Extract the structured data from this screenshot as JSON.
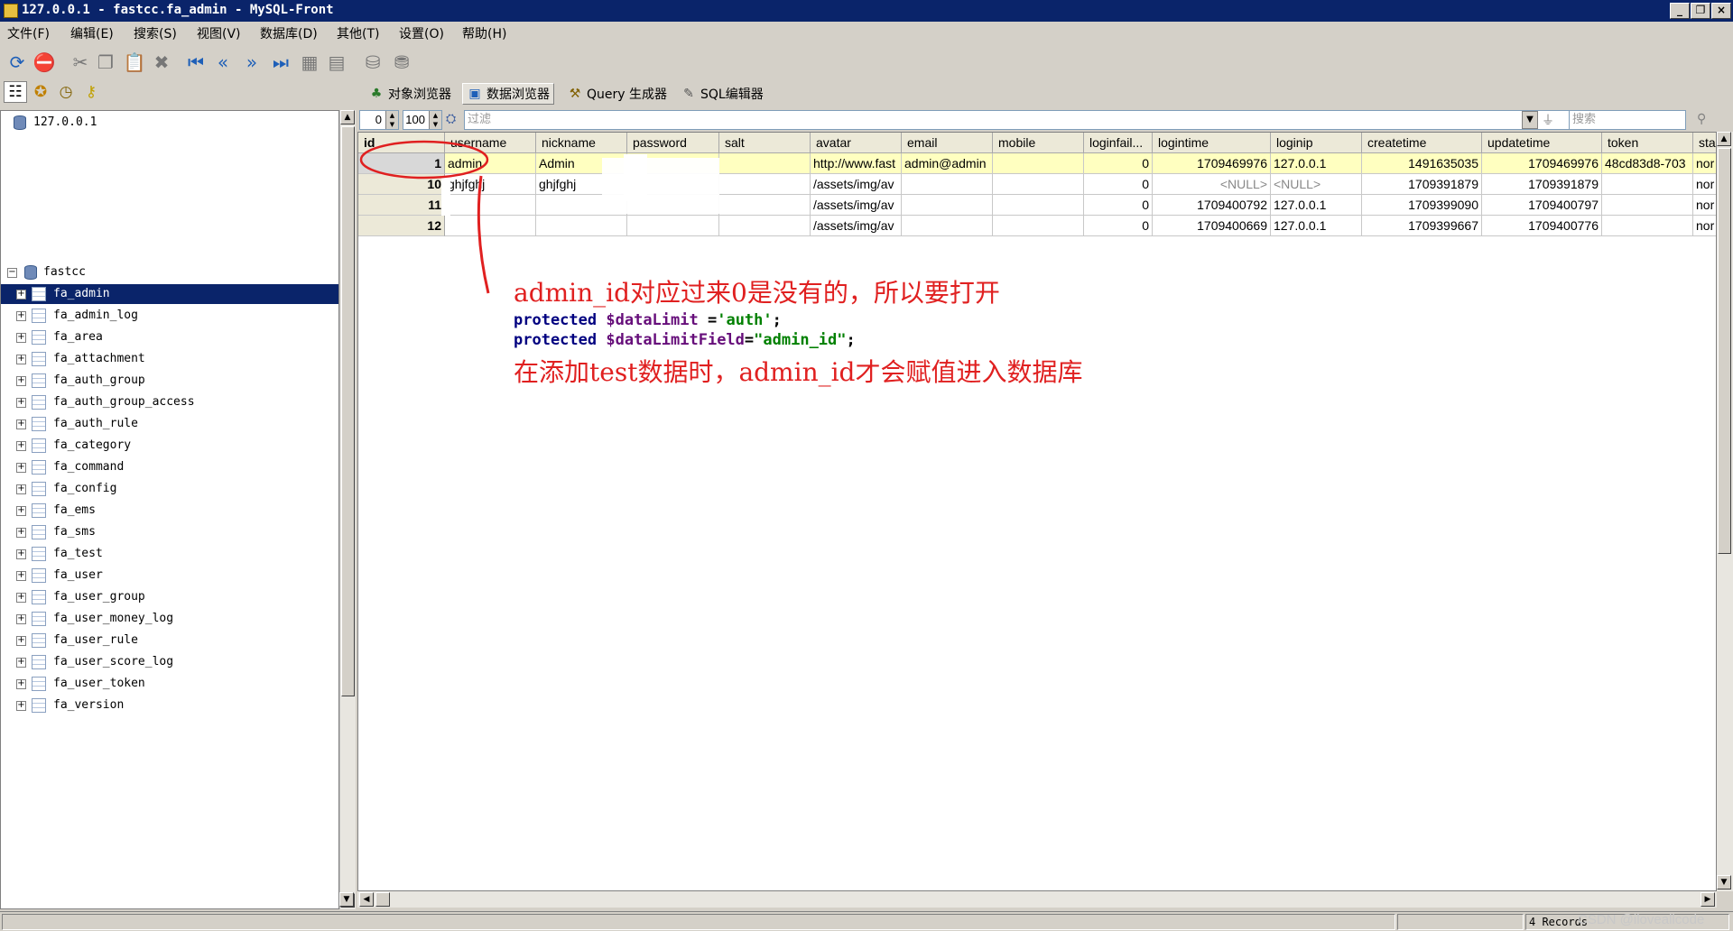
{
  "window": {
    "title": "127.0.0.1 - fastcc.fa_admin - MySQL-Front",
    "buttons": [
      "_",
      "❐",
      "×"
    ]
  },
  "menu": [
    "文件(F)",
    "编辑(E)",
    "搜索(S)",
    "视图(V)",
    "数据库(D)",
    "其他(T)",
    "设置(O)",
    "帮助(H)"
  ],
  "toolbar": {
    "icons": [
      "refresh-icon",
      "stop-icon",
      "cut-icon",
      "copy-icon",
      "paste-icon",
      "delete-icon",
      "first-icon",
      "prev-icon",
      "next-icon",
      "last-icon",
      "insert-row-icon",
      "delete-row-icon",
      "commit-icon",
      "rollback-icon"
    ]
  },
  "left_tabs": [
    "tree-view-icon",
    "favorites-icon",
    "history-icon",
    "keys-icon"
  ],
  "view_tabs": [
    {
      "label": "对象浏览器",
      "icon": "object-browser-icon"
    },
    {
      "label": "数据浏览器",
      "icon": "data-browser-icon"
    },
    {
      "label": "Query 生成器",
      "icon": "query-builder-icon"
    },
    {
      "label": "SQL编辑器",
      "icon": "sql-editor-icon"
    }
  ],
  "tree": {
    "server": "127.0.0.1",
    "database": "fastcc",
    "tables": [
      "fa_admin",
      "fa_admin_log",
      "fa_area",
      "fa_attachment",
      "fa_auth_group",
      "fa_auth_group_access",
      "fa_auth_rule",
      "fa_category",
      "fa_command",
      "fa_config",
      "fa_ems",
      "fa_sms",
      "fa_test",
      "fa_user",
      "fa_user_group",
      "fa_user_money_log",
      "fa_user_rule",
      "fa_user_score_log",
      "fa_user_token",
      "fa_version"
    ],
    "selected": "fa_admin"
  },
  "filter": {
    "offset": "0",
    "limit": "100",
    "filter_placeholder": "过滤",
    "search_placeholder": "搜索"
  },
  "grid": {
    "columns": [
      "id",
      "username",
      "nickname",
      "password",
      "salt",
      "avatar",
      "email",
      "mobile",
      "loginfail...",
      "logintime",
      "loginip",
      "createtime",
      "updatetime",
      "token",
      "sta"
    ],
    "rows": [
      [
        "1",
        "admin",
        "Admin",
        "",
        "",
        "http://www.fast",
        "admin@admin",
        "",
        "0",
        "1709469976",
        "127.0.0.1",
        "1491635035",
        "1709469976",
        "48cd83d8-703",
        "nor"
      ],
      [
        "10",
        "ghjfghj",
        "ghjfghj",
        "",
        "",
        "/assets/img/av",
        "",
        "",
        "0",
        "<NULL>",
        "<NULL>",
        "1709391879",
        "1709391879",
        "",
        "nor"
      ],
      [
        "11",
        "",
        "",
        "",
        "",
        "/assets/img/av",
        "",
        "",
        "0",
        "1709400792",
        "127.0.0.1",
        "1709399090",
        "1709400797",
        "",
        "nor"
      ],
      [
        "12",
        "",
        "",
        "",
        "",
        "/assets/img/av",
        "",
        "",
        "0",
        "1709400669",
        "127.0.0.1",
        "1709399667",
        "1709400776",
        "",
        "nor"
      ]
    ]
  },
  "annotation": {
    "line1": "admin_id对应过来0是没有的，所以要打开",
    "code1": {
      "kw": "protected",
      "var": "$dataLimit",
      "op": " =",
      "str": "'auth'",
      "end": ";"
    },
    "code2": {
      "kw": "protected",
      "var": "$dataLimitField",
      "op": "=",
      "str": "\"admin_id\"",
      "end": ";"
    },
    "line2": "在添加test数据时，admin_id才会赋值进入数据库",
    "color": "#e02020"
  },
  "status": {
    "records": "4 Records",
    "watermark": "CSDN @iloveallcode"
  }
}
